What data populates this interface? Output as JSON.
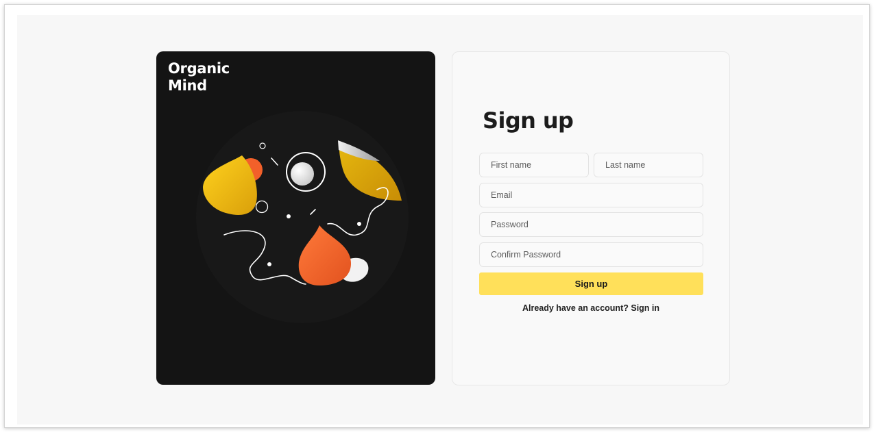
{
  "brand": {
    "line1": "Organic",
    "line2": "Mind"
  },
  "form": {
    "title": "Sign up",
    "first_name_placeholder": "First name",
    "last_name_placeholder": "Last name",
    "email_placeholder": "Email",
    "password_placeholder": "Password",
    "confirm_password_placeholder": "Confirm Password",
    "submit_label": "Sign up",
    "signin_prompt": "Already have an account?",
    "signin_link": "Sign in"
  },
  "colors": {
    "accent": "#ffe05a",
    "art_background": "#141414",
    "illustration_yellow": "#f0be14",
    "illustration_orange": "#f2602a"
  },
  "icons": {
    "illustration": "abstract-organic-shapes-illustration"
  }
}
